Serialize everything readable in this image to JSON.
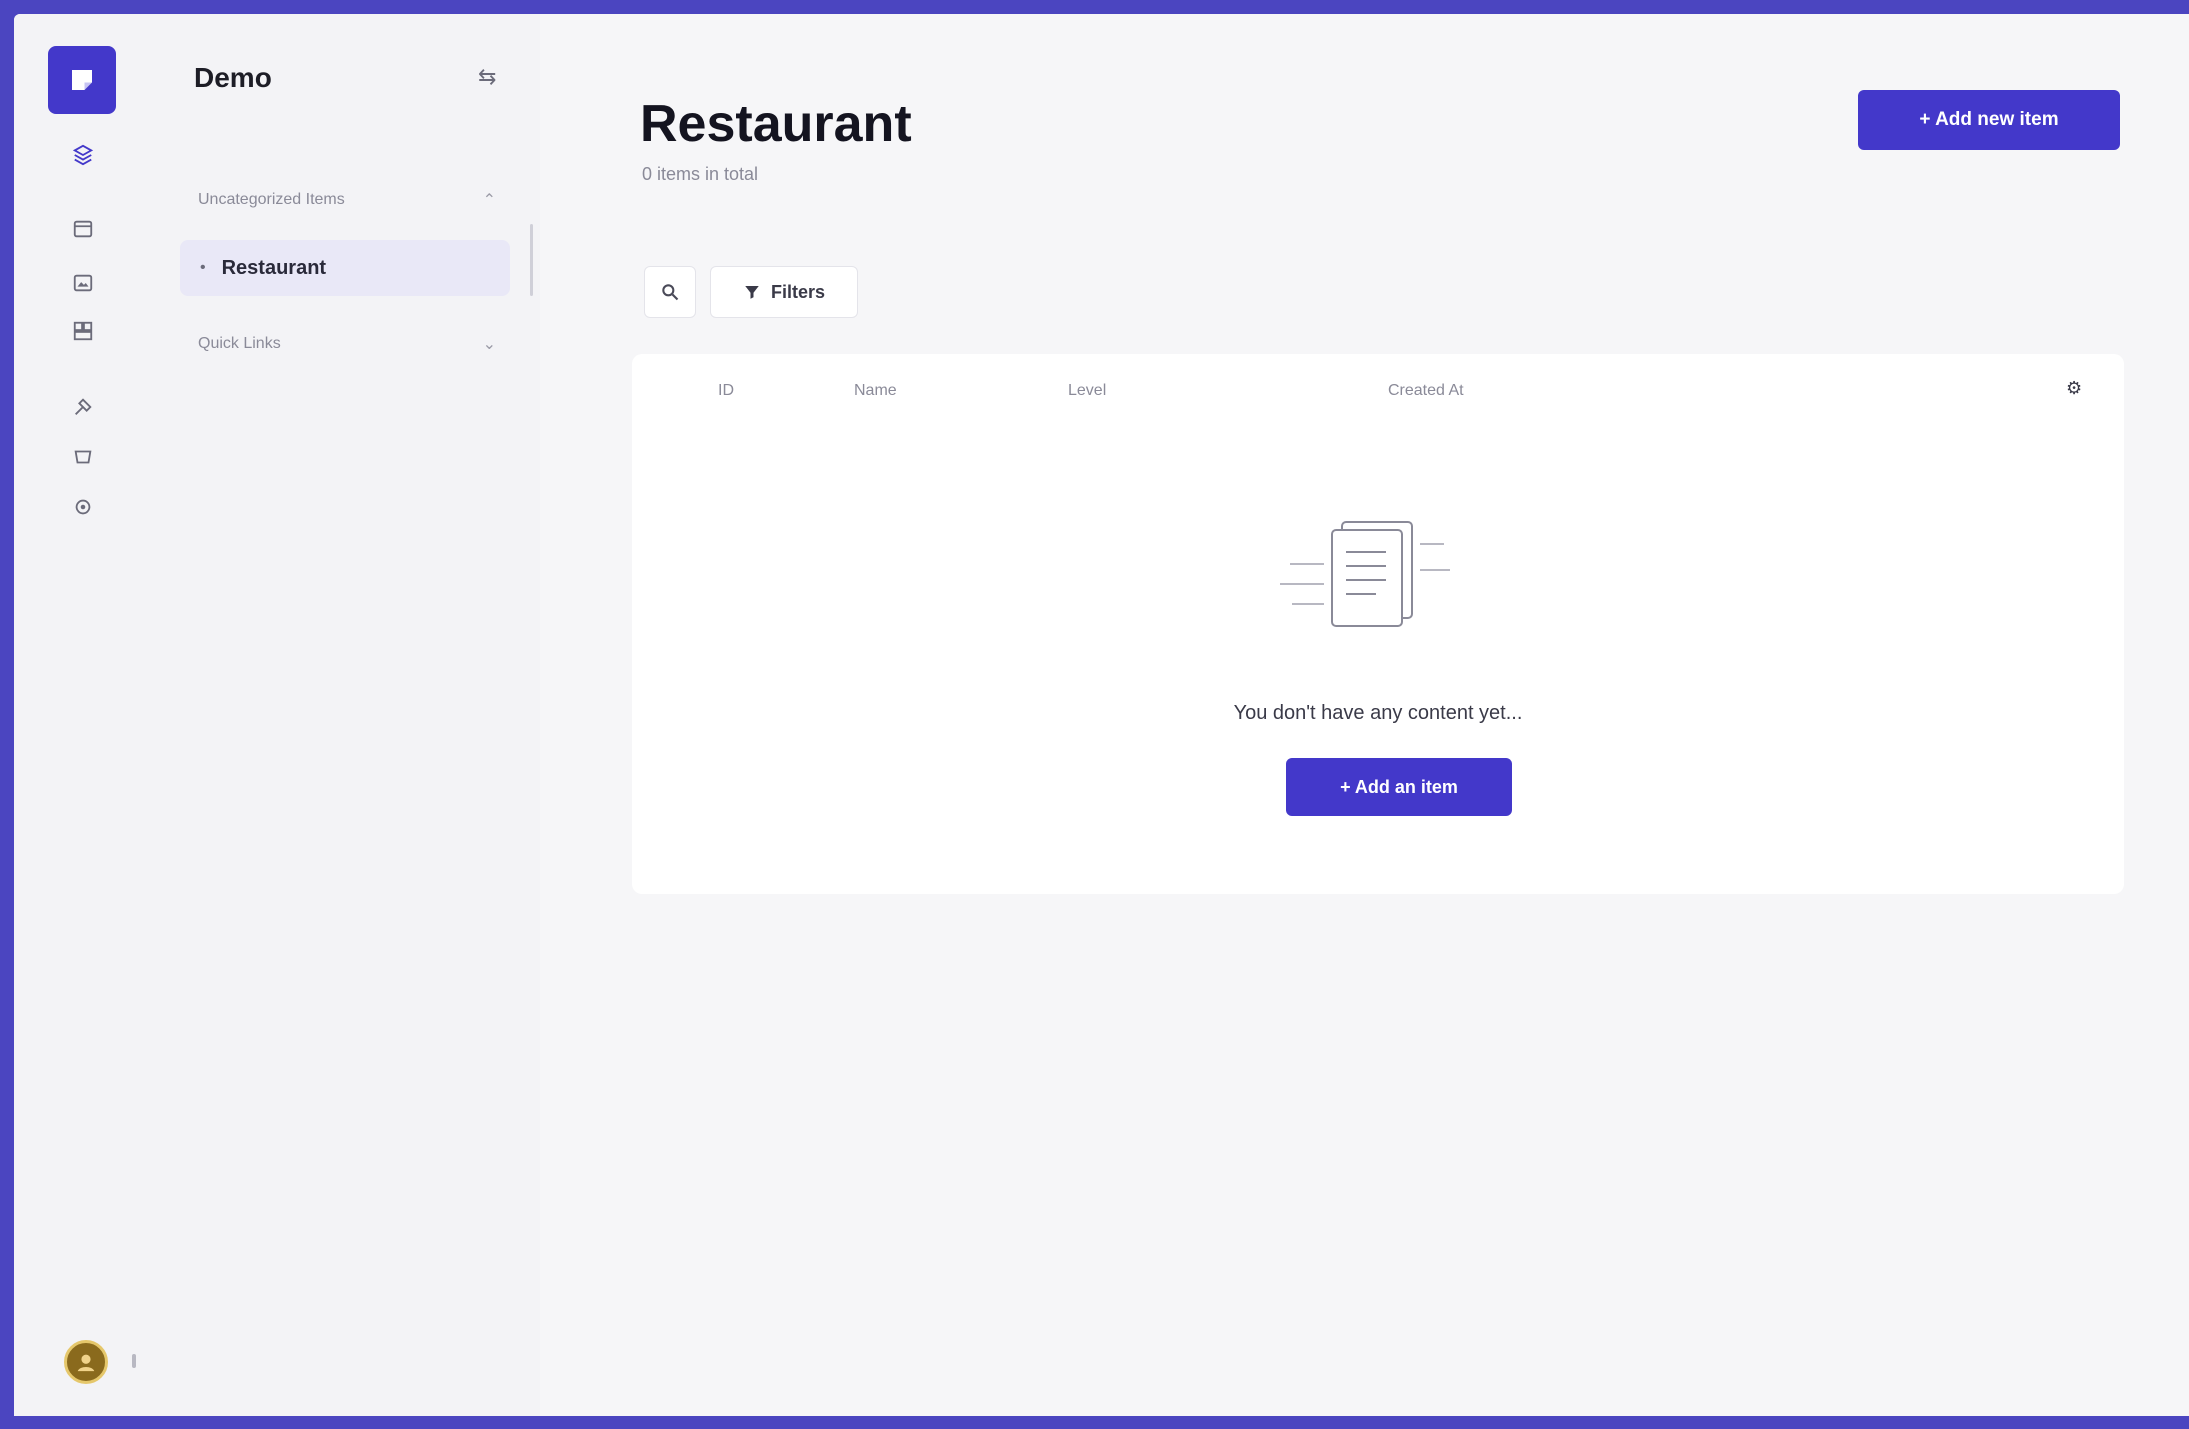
{
  "sidebar": {
    "workspace_name": "Demo",
    "workspace_toggle": "⇆",
    "groups": [
      {
        "label": "Uncategorized Items"
      },
      {
        "label": "Quick Links"
      }
    ],
    "active_item": {
      "bullet": "•",
      "label": "Restaurant"
    }
  },
  "page": {
    "title": "Restaurant",
    "subtitle": "0 items in total",
    "primary_action": "+ Add new item"
  },
  "toolbar": {
    "filter_label": "Filters"
  },
  "table": {
    "columns": [
      "ID",
      "Name",
      "Level",
      "Created At"
    ]
  },
  "empty_state": {
    "message": "You don't have any content yet...",
    "button_label": "+ Add an item"
  },
  "colors": {
    "accent": "#4338ca",
    "frame": "#4b45c0"
  }
}
